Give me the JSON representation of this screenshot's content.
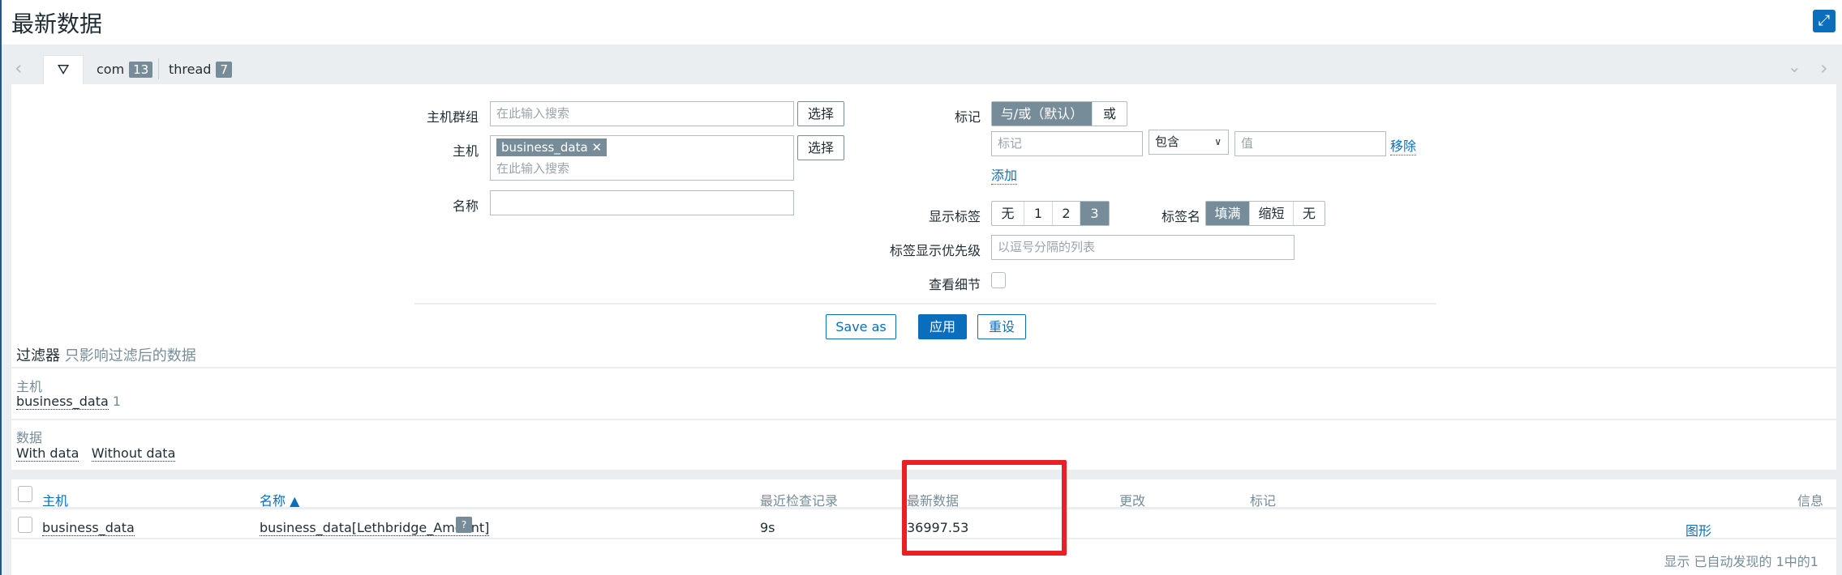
{
  "page": {
    "title": "最新数据"
  },
  "tabs": {
    "filter_icon": "funnel-icon",
    "items": [
      {
        "label": "com",
        "count": "13"
      },
      {
        "label": "thread",
        "count": "7"
      }
    ]
  },
  "filter": {
    "host_groups": {
      "label": "主机群组",
      "placeholder": "在此输入搜索",
      "select": "选择"
    },
    "hosts": {
      "label": "主机",
      "chip": "business_data",
      "placeholder": "在此输入搜索",
      "select": "选择"
    },
    "name": {
      "label": "名称",
      "value": ""
    },
    "tags": {
      "label": "标记",
      "modes": [
        "与/或（默认）",
        "或"
      ],
      "selected_mode": "与/或（默认）",
      "tag_placeholder": "标记",
      "operator": "包含",
      "value_placeholder": "值",
      "remove": "移除",
      "add": "添加"
    },
    "show_tags": {
      "label": "显示标签",
      "options": [
        "无",
        "1",
        "2",
        "3"
      ],
      "selected": "3"
    },
    "tag_name": {
      "label": "标签名",
      "options": [
        "填满",
        "缩短",
        "无"
      ],
      "selected": "填满"
    },
    "tag_priority": {
      "label": "标签显示优先级",
      "placeholder": "以逗号分隔的列表"
    },
    "show_details": {
      "label": "查看细节",
      "checked": false
    },
    "buttons": {
      "save_as": "Save as",
      "apply": "应用",
      "reset": "重设"
    }
  },
  "subfilter": {
    "title": "过滤器",
    "hint": "只影响过滤后的数据",
    "host_label": "主机",
    "host_value": "business_data",
    "host_count": "1",
    "data_label": "数据",
    "data_options": [
      "With data",
      "Without data"
    ]
  },
  "table": {
    "columns": [
      "主机",
      "名称 ▲",
      "最近检查记录",
      "最新数据",
      "更改",
      "标记",
      "信息"
    ],
    "rows": [
      {
        "host": "business_data",
        "name": "business_data[Lethbridge_Amount]",
        "last_check": "9s",
        "last_value": "36997.53",
        "change": "",
        "tags": "",
        "info": "图形"
      }
    ],
    "footer": "显示 已自动发现的 1中的1"
  },
  "colors": {
    "accent": "#0a6ebd",
    "highlight": "#e8202a",
    "chip": "#768d99"
  }
}
